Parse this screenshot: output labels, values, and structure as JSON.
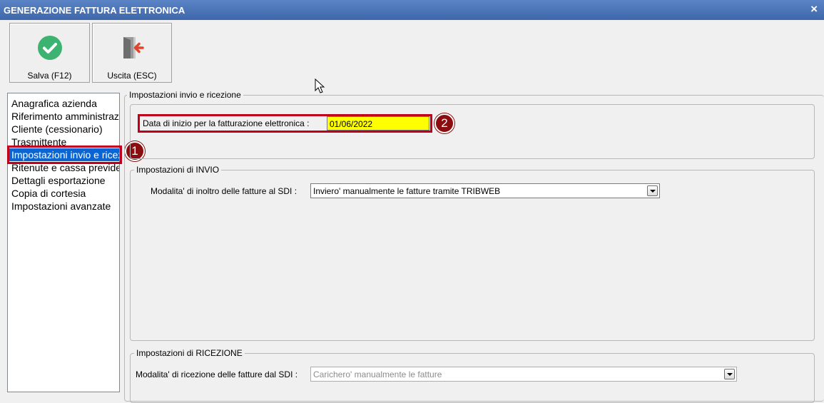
{
  "window": {
    "title": "GENERAZIONE FATTURA ELETTRONICA",
    "close_glyph": "×"
  },
  "toolbar": {
    "save_label": "Salva (F12)",
    "save_icon": "check-circle-icon",
    "exit_label": "Uscita (ESC)",
    "exit_icon": "door-exit-icon"
  },
  "sidebar": {
    "items": [
      {
        "label": "Anagrafica azienda"
      },
      {
        "label": "Riferimento amministrazione"
      },
      {
        "label": "Cliente (cessionario)"
      },
      {
        "label": "Trasmittente"
      },
      {
        "label": "Impostazioni invio e ricezione",
        "selected": true
      },
      {
        "label": "Ritenute e cassa previdenziale"
      },
      {
        "label": "Dettagli esportazione"
      },
      {
        "label": "Copia di cortesia"
      },
      {
        "label": "Impostazioni avanzate"
      }
    ]
  },
  "annotations": {
    "marker1": "1",
    "marker2": "2",
    "marker_color": "#8b0d0f",
    "highlight_color": "#c0001a"
  },
  "general": {
    "group_title": "Impostazioni invio e ricezione",
    "start_date_label": "Data di inizio per la fatturazione elettronica :",
    "start_date_value": "01/06/2022"
  },
  "send": {
    "group_title": "Impostazioni di INVIO",
    "mode_label": "Modalita' di inoltro delle fatture al SDI :",
    "mode_value": "Inviero' manualmente le fatture tramite TRIBWEB"
  },
  "receive": {
    "group_title": "Impostazioni di RICEZIONE",
    "mode_label": "Modalita' di ricezione delle fatture dal SDI :",
    "mode_value": "Carichero' manualmente le fatture"
  },
  "colors": {
    "titlebar": "#4a74b8",
    "selection": "#0a64d1",
    "date_field": "#ffff00"
  }
}
